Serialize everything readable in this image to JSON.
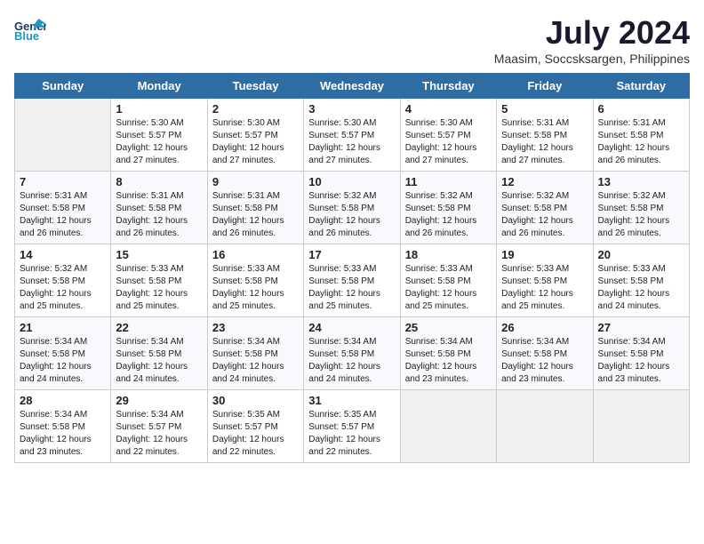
{
  "header": {
    "logo_general": "General",
    "logo_blue": "Blue",
    "month_year": "July 2024",
    "location": "Maasim, Soccsksargen, Philippines"
  },
  "days_of_week": [
    "Sunday",
    "Monday",
    "Tuesday",
    "Wednesday",
    "Thursday",
    "Friday",
    "Saturday"
  ],
  "weeks": [
    [
      {
        "day": "",
        "empty": true
      },
      {
        "day": "1",
        "sunrise": "5:30 AM",
        "sunset": "5:57 PM",
        "daylight": "12 hours and 27 minutes."
      },
      {
        "day": "2",
        "sunrise": "5:30 AM",
        "sunset": "5:57 PM",
        "daylight": "12 hours and 27 minutes."
      },
      {
        "day": "3",
        "sunrise": "5:30 AM",
        "sunset": "5:57 PM",
        "daylight": "12 hours and 27 minutes."
      },
      {
        "day": "4",
        "sunrise": "5:30 AM",
        "sunset": "5:57 PM",
        "daylight": "12 hours and 27 minutes."
      },
      {
        "day": "5",
        "sunrise": "5:31 AM",
        "sunset": "5:58 PM",
        "daylight": "12 hours and 27 minutes."
      },
      {
        "day": "6",
        "sunrise": "5:31 AM",
        "sunset": "5:58 PM",
        "daylight": "12 hours and 26 minutes."
      }
    ],
    [
      {
        "day": "7",
        "sunrise": "5:31 AM",
        "sunset": "5:58 PM",
        "daylight": "12 hours and 26 minutes."
      },
      {
        "day": "8",
        "sunrise": "5:31 AM",
        "sunset": "5:58 PM",
        "daylight": "12 hours and 26 minutes."
      },
      {
        "day": "9",
        "sunrise": "5:31 AM",
        "sunset": "5:58 PM",
        "daylight": "12 hours and 26 minutes."
      },
      {
        "day": "10",
        "sunrise": "5:32 AM",
        "sunset": "5:58 PM",
        "daylight": "12 hours and 26 minutes."
      },
      {
        "day": "11",
        "sunrise": "5:32 AM",
        "sunset": "5:58 PM",
        "daylight": "12 hours and 26 minutes."
      },
      {
        "day": "12",
        "sunrise": "5:32 AM",
        "sunset": "5:58 PM",
        "daylight": "12 hours and 26 minutes."
      },
      {
        "day": "13",
        "sunrise": "5:32 AM",
        "sunset": "5:58 PM",
        "daylight": "12 hours and 26 minutes."
      }
    ],
    [
      {
        "day": "14",
        "sunrise": "5:32 AM",
        "sunset": "5:58 PM",
        "daylight": "12 hours and 25 minutes."
      },
      {
        "day": "15",
        "sunrise": "5:33 AM",
        "sunset": "5:58 PM",
        "daylight": "12 hours and 25 minutes."
      },
      {
        "day": "16",
        "sunrise": "5:33 AM",
        "sunset": "5:58 PM",
        "daylight": "12 hours and 25 minutes."
      },
      {
        "day": "17",
        "sunrise": "5:33 AM",
        "sunset": "5:58 PM",
        "daylight": "12 hours and 25 minutes."
      },
      {
        "day": "18",
        "sunrise": "5:33 AM",
        "sunset": "5:58 PM",
        "daylight": "12 hours and 25 minutes."
      },
      {
        "day": "19",
        "sunrise": "5:33 AM",
        "sunset": "5:58 PM",
        "daylight": "12 hours and 25 minutes."
      },
      {
        "day": "20",
        "sunrise": "5:33 AM",
        "sunset": "5:58 PM",
        "daylight": "12 hours and 24 minutes."
      }
    ],
    [
      {
        "day": "21",
        "sunrise": "5:34 AM",
        "sunset": "5:58 PM",
        "daylight": "12 hours and 24 minutes."
      },
      {
        "day": "22",
        "sunrise": "5:34 AM",
        "sunset": "5:58 PM",
        "daylight": "12 hours and 24 minutes."
      },
      {
        "day": "23",
        "sunrise": "5:34 AM",
        "sunset": "5:58 PM",
        "daylight": "12 hours and 24 minutes."
      },
      {
        "day": "24",
        "sunrise": "5:34 AM",
        "sunset": "5:58 PM",
        "daylight": "12 hours and 24 minutes."
      },
      {
        "day": "25",
        "sunrise": "5:34 AM",
        "sunset": "5:58 PM",
        "daylight": "12 hours and 23 minutes."
      },
      {
        "day": "26",
        "sunrise": "5:34 AM",
        "sunset": "5:58 PM",
        "daylight": "12 hours and 23 minutes."
      },
      {
        "day": "27",
        "sunrise": "5:34 AM",
        "sunset": "5:58 PM",
        "daylight": "12 hours and 23 minutes."
      }
    ],
    [
      {
        "day": "28",
        "sunrise": "5:34 AM",
        "sunset": "5:58 PM",
        "daylight": "12 hours and 23 minutes."
      },
      {
        "day": "29",
        "sunrise": "5:34 AM",
        "sunset": "5:57 PM",
        "daylight": "12 hours and 22 minutes."
      },
      {
        "day": "30",
        "sunrise": "5:35 AM",
        "sunset": "5:57 PM",
        "daylight": "12 hours and 22 minutes."
      },
      {
        "day": "31",
        "sunrise": "5:35 AM",
        "sunset": "5:57 PM",
        "daylight": "12 hours and 22 minutes."
      },
      {
        "day": "",
        "empty": true
      },
      {
        "day": "",
        "empty": true
      },
      {
        "day": "",
        "empty": true
      }
    ]
  ],
  "labels": {
    "sunrise_prefix": "Sunrise: ",
    "sunset_prefix": "Sunset: ",
    "daylight_prefix": "Daylight: "
  }
}
